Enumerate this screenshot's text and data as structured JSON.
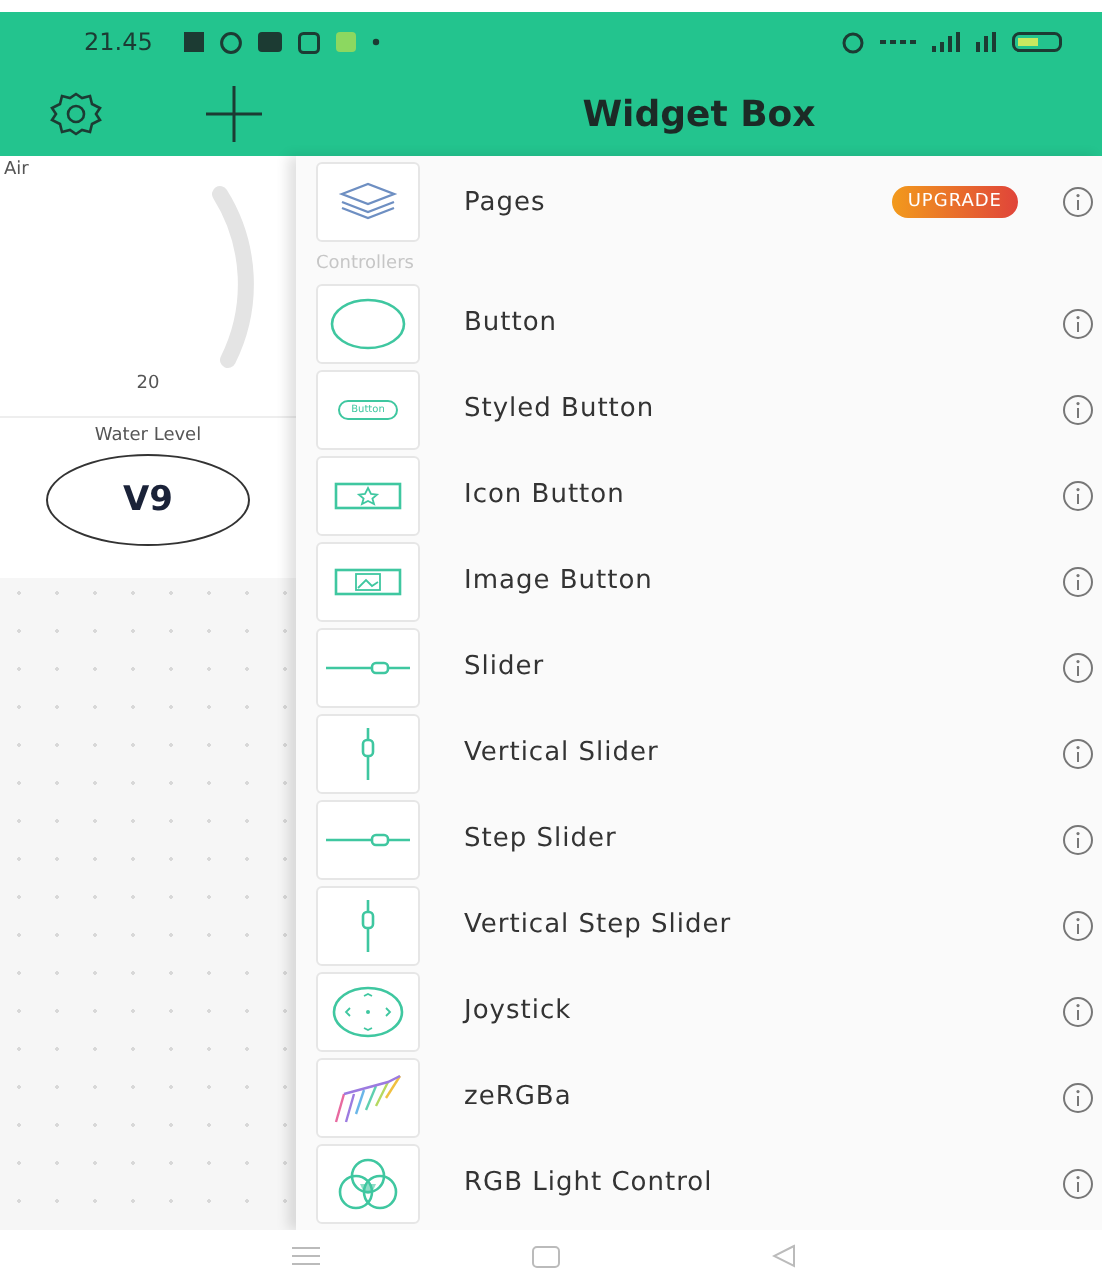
{
  "status_bar": {
    "time": "21.45"
  },
  "toolbar": {
    "title": "Widget Box"
  },
  "dashboard": {
    "gauge": {
      "label": "Air",
      "value": "20"
    },
    "display": {
      "label": "Water Level",
      "pin": "V9"
    }
  },
  "featured": {
    "name": "Pages",
    "kind": "pages",
    "badge": "UPGRADE"
  },
  "section": "Controllers",
  "widgets": [
    {
      "name": "Button",
      "kind": "button"
    },
    {
      "name": "Styled Button",
      "kind": "styled",
      "icon_text": "Button"
    },
    {
      "name": "Icon Button",
      "kind": "icon"
    },
    {
      "name": "Image Button",
      "kind": "image"
    },
    {
      "name": "Slider",
      "kind": "slider"
    },
    {
      "name": "Vertical Slider",
      "kind": "vslider"
    },
    {
      "name": "Step Slider",
      "kind": "slider"
    },
    {
      "name": "Vertical Step Slider",
      "kind": "vslider"
    },
    {
      "name": "Joystick",
      "kind": "joystick"
    },
    {
      "name": "zeRGBa",
      "kind": "zergba"
    },
    {
      "name": "RGB Light Control",
      "kind": "rgb"
    }
  ]
}
